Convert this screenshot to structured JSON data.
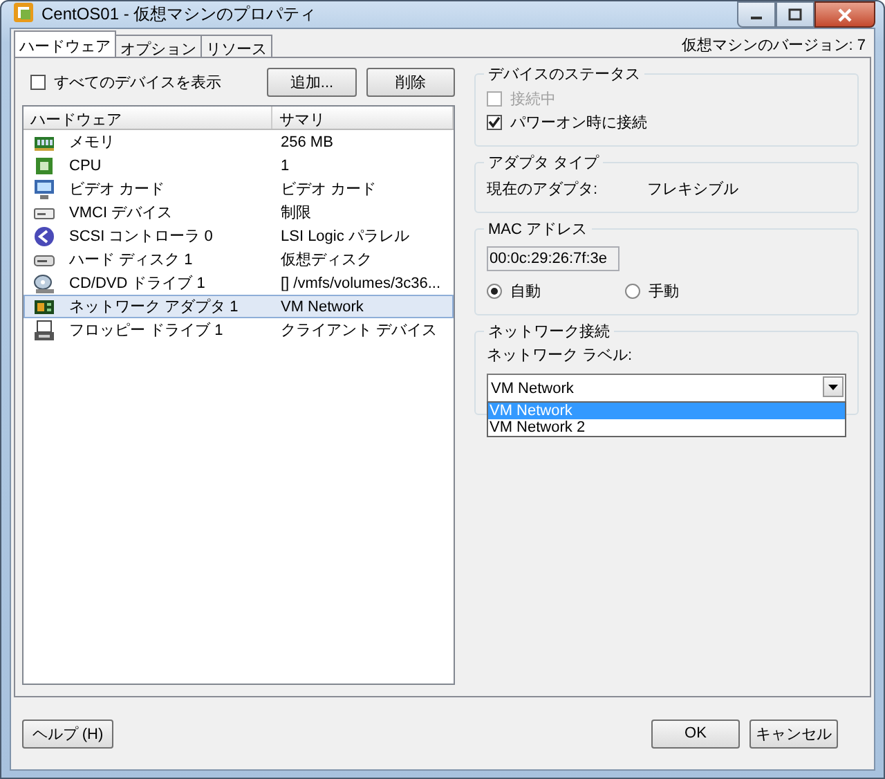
{
  "window": {
    "title": "CentOS01 - 仮想マシンのプロパティ"
  },
  "tabs": [
    {
      "label": "ハードウェア",
      "selected": true
    },
    {
      "label": "オプション",
      "selected": false
    },
    {
      "label": "リソース",
      "selected": false
    }
  ],
  "vm_version": "仮想マシンのバージョン: 7",
  "show_all_devices": {
    "label": "すべてのデバイスを表示",
    "checked": false
  },
  "hardware_buttons": [
    "追加...",
    "削除"
  ],
  "table": {
    "columns": [
      "ハードウェア",
      "サマリ"
    ],
    "rows": [
      {
        "kind": "memory",
        "name": "メモリ",
        "summary": "256 MB",
        "selected": false
      },
      {
        "kind": "cpu",
        "name": "CPU",
        "summary": "1",
        "selected": false
      },
      {
        "kind": "video",
        "name": "ビデオ カード",
        "summary": "ビデオ カード",
        "selected": false
      },
      {
        "kind": "device",
        "name": "VMCI デバイス",
        "summary": "制限",
        "selected": false
      },
      {
        "kind": "scsi",
        "name": "SCSI コントローラ 0",
        "summary": "LSI Logic パラレル",
        "selected": false
      },
      {
        "kind": "disk",
        "name": "ハード ディスク 1",
        "summary": "仮想ディスク",
        "selected": false
      },
      {
        "kind": "cdrom",
        "name": "CD/DVD ドライブ 1",
        "summary": "[] /vmfs/volumes/3c36...",
        "selected": false
      },
      {
        "kind": "network",
        "name": "ネットワーク アダプタ 1",
        "summary": "VM Network",
        "selected": true
      },
      {
        "kind": "floppy",
        "name": "フロッピー ドライブ 1",
        "summary": "クライアント デバイス",
        "selected": false
      }
    ]
  },
  "device_status": {
    "title": "デバイスのステータス",
    "options": [
      {
        "label": "接続中",
        "checked": false,
        "disabled": true
      },
      {
        "label": "パワーオン時に接続",
        "checked": true,
        "disabled": false
      }
    ]
  },
  "adapter_type": {
    "title": "アダプタ タイプ",
    "label": "現在のアダプタ:",
    "value": "フレキシブル"
  },
  "mac_address": {
    "title": "MAC アドレス",
    "value": "00:0c:29:26:7f:3e",
    "options": [
      {
        "label": "自動",
        "selected": true
      },
      {
        "label": "手動",
        "selected": false
      }
    ]
  },
  "network_connection": {
    "title": "ネットワーク接続",
    "label": "ネットワーク ラベル:",
    "value": "VM Network",
    "options": [
      {
        "label": "VM Network",
        "selected": true
      },
      {
        "label": "VM Network 2",
        "selected": false
      }
    ]
  },
  "footer_buttons": [
    {
      "kind": "help",
      "label": "ヘルプ (H)"
    },
    {
      "kind": "ok",
      "label": "OK"
    },
    {
      "kind": "cancel",
      "label": "キャンセル"
    }
  ]
}
